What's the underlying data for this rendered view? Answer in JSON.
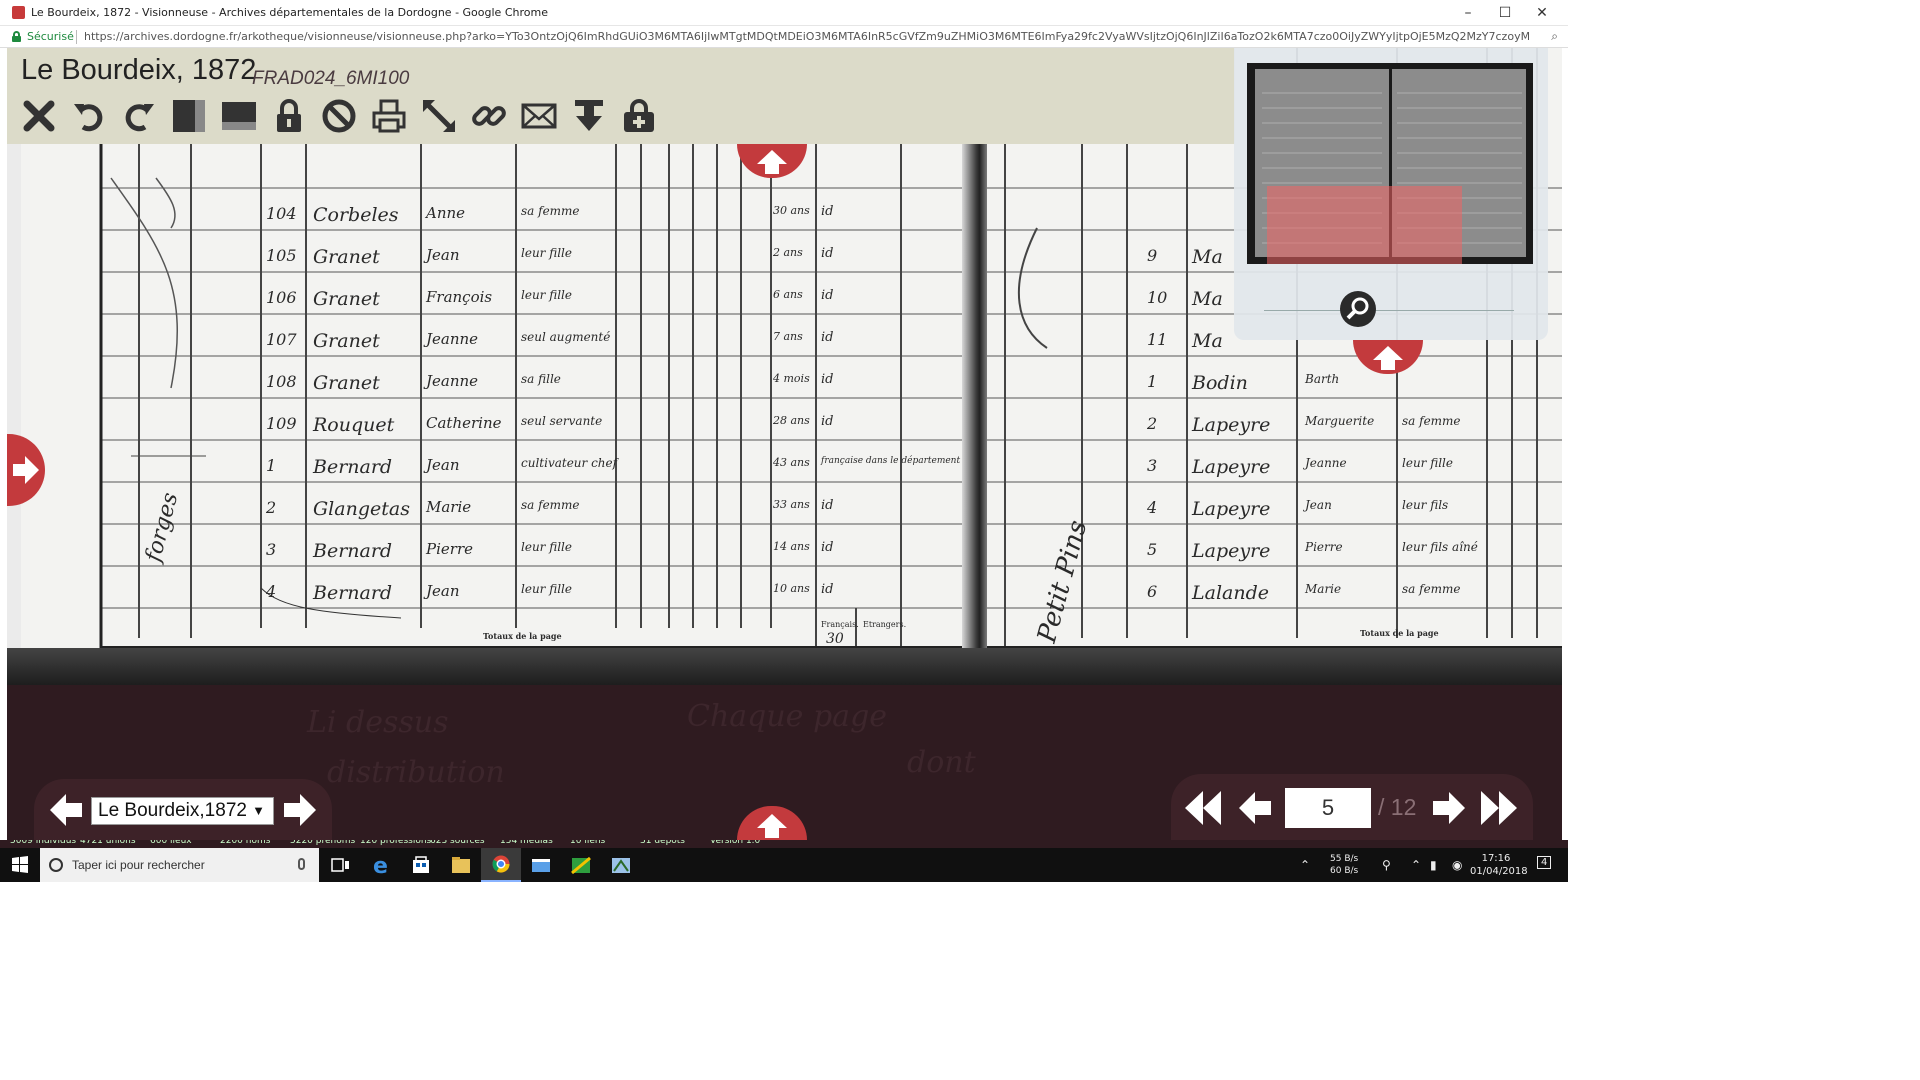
{
  "window": {
    "title": "Le Bourdeix, 1872 - Visionneuse - Archives départementales de la Dordogne - Google Chrome"
  },
  "addressbar": {
    "secure_label": "Sécurisé",
    "url": "https://archives.dordogne.fr/arkotheque/visionneuse/visionneuse.php?arko=YTo3OntzOjQ6ImRhdGUiO3M6MTA6IjIwMTgtMDQtMDEiO3M6MTA6InR5cGVfZm9uZHMiO3M6MTE6ImFya29fc2VyaWVsIjtzOjQ6InJlZiI6aTozO2k6MTA7czo0OiJyZWYyIjtpOjE5MzQ2MzY7czoyMDoicmVmX3VuaXRlX2NvbnRleHRlIjtpOjE5MzQ2MzY7czoxNjoiZm9uZHNfY29udGV4dGUiO2FyYXk6Mjp7..."
  },
  "viewer": {
    "doc_title": "Le Bourdeix, 1872",
    "doc_code": "FRAD024_6MI100",
    "toolbar": [
      {
        "name": "close-icon",
        "label": "close"
      },
      {
        "name": "rotate-left-icon",
        "label": "rotate left"
      },
      {
        "name": "rotate-right-icon",
        "label": "rotate right"
      },
      {
        "name": "single-page-icon",
        "label": "single page"
      },
      {
        "name": "double-page-icon",
        "label": "double page"
      },
      {
        "name": "lock-icon",
        "label": "lock"
      },
      {
        "name": "reset-icon",
        "label": "reset"
      },
      {
        "name": "print-icon",
        "label": "print"
      },
      {
        "name": "fullscreen-icon",
        "label": "fullscreen"
      },
      {
        "name": "link-icon",
        "label": "link"
      },
      {
        "name": "email-icon",
        "label": "email"
      },
      {
        "name": "download-icon",
        "label": "download"
      },
      {
        "name": "add-to-basket-icon",
        "label": "add"
      }
    ],
    "navigation": {
      "selected_document": "Le Bourdeix,1872",
      "current_page": "5",
      "total_pages": "/ 12"
    }
  },
  "register": {
    "left_rows": [
      {
        "num": "104",
        "surname": "Corbeles",
        "first": "Anne",
        "role": "sa femme",
        "age": "30 ans",
        "note": "id"
      },
      {
        "num": "105",
        "surname": "Granet",
        "first": "Jean",
        "role": "leur fille",
        "age": "2 ans",
        "note": "id"
      },
      {
        "num": "106",
        "surname": "Granet",
        "first": "François",
        "role": "leur fille",
        "age": "6 ans",
        "note": "id"
      },
      {
        "num": "107",
        "surname": "Granet",
        "first": "Jeanne",
        "role": "seul augmenté",
        "age": "7 ans",
        "note": "id"
      },
      {
        "num": "108",
        "surname": "Granet",
        "first": "Jeanne",
        "role": "sa fille",
        "age": "4 mois",
        "note": "id"
      },
      {
        "num": "109",
        "surname": "Rouquet",
        "first": "Catherine",
        "role": "seul servante",
        "age": "28 ans",
        "note": "id"
      },
      {
        "num": "1",
        "surname": "Bernard",
        "first": "Jean",
        "role": "cultivateur chef",
        "age": "43 ans",
        "note": "française dans le département"
      },
      {
        "num": "2",
        "surname": "Glangetas",
        "first": "Marie",
        "role": "sa femme",
        "age": "33 ans",
        "note": "id"
      },
      {
        "num": "3",
        "surname": "Bernard",
        "first": "Pierre",
        "role": "leur fille",
        "age": "14 ans",
        "note": "id"
      },
      {
        "num": "4",
        "surname": "Bernard",
        "first": "Jean",
        "role": "leur fille",
        "age": "10 ans",
        "note": "id"
      }
    ],
    "left_totals": "Totaux de la page",
    "col_francais": "Français.",
    "col_etrangers": "Etrangers.",
    "total_value": "30",
    "margin_note": "forges",
    "right_rows": [
      {
        "num": "9",
        "surname": "Ma"
      },
      {
        "num": "10",
        "surname": "Ma"
      },
      {
        "num": "11",
        "surname": "Ma"
      },
      {
        "num": "1",
        "surname": "Bodin",
        "first": "Barth"
      },
      {
        "num": "2",
        "surname": "Lapeyre",
        "first": "Marguerite",
        "role": "sa femme"
      },
      {
        "num": "3",
        "surname": "Lapeyre",
        "first": "Jeanne",
        "role": "leur fille"
      },
      {
        "num": "4",
        "surname": "Lapeyre",
        "first": "Jean",
        "role": "leur fils"
      },
      {
        "num": "5",
        "surname": "Lapeyre",
        "first": "Pierre",
        "role": "leur fils aîné"
      },
      {
        "num": "6",
        "surname": "Lalande",
        "first": "Marie",
        "role": "sa femme"
      }
    ],
    "right_totals": "Totaux de la page",
    "right_margin": "Petit Pins"
  },
  "status_strip": [
    "5009 individus",
    "4721 unions",
    "600 lieux",
    "2200 noms",
    "5220 prénoms",
    "120 professions",
    "623 sources",
    "154 médias",
    "10 liens",
    "31 dépôts",
    "Version 1.0"
  ],
  "taskbar": {
    "search_placeholder": "Taper ici pour rechercher",
    "net_up": "55 B/s",
    "net_down": "60 B/s",
    "time": "17:16",
    "date": "01/04/2018",
    "notif_count": "4"
  },
  "colors": {
    "accent_red": "#c33a3d",
    "panel_beige": "#dcdbc9",
    "nav_dark": "#3d2228",
    "secure_green": "#1e8a3e"
  }
}
